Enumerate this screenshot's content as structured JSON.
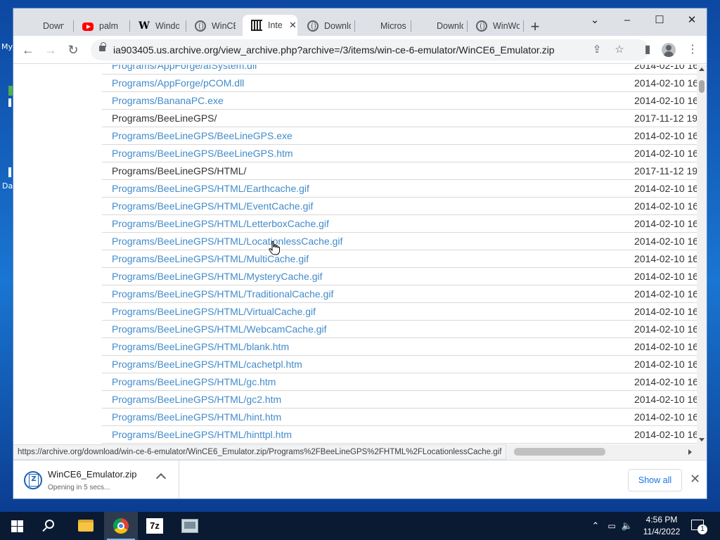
{
  "desktop": {
    "labels": [
      "My",
      "Da"
    ]
  },
  "tabs": [
    {
      "label": "Downlo",
      "icon": "microsoft-icon"
    },
    {
      "label": "palm o",
      "icon": "youtube-icon"
    },
    {
      "label": "Windo",
      "icon": "wikipedia-icon"
    },
    {
      "label": "WinCE",
      "icon": "globe-icon"
    },
    {
      "label": "Inte",
      "icon": "internet-archive-icon",
      "active": true
    },
    {
      "label": "Downlo",
      "icon": "globe-icon"
    },
    {
      "label": "Micros",
      "icon": "microsoft-icon"
    },
    {
      "label": "Downlo",
      "icon": "microsoft-icon"
    },
    {
      "label": "WinWo",
      "icon": "globe-icon"
    }
  ],
  "window_controls": {
    "minimize": "–",
    "maximize": "☐",
    "close": "✕",
    "tab_search": "⌄",
    "new_tab": "+"
  },
  "toolbar": {
    "url": "ia903405.us.archive.org/view_archive.php?archive=/3/items/win-ce-6-emulator/WinCE6_Emulator.zip"
  },
  "files": [
    {
      "name": "Programs/AppForge/afSystem.dll",
      "date": "2014-02-10 16",
      "folder": false
    },
    {
      "name": "Programs/AppForge/pCOM.dll",
      "date": "2014-02-10 16",
      "folder": false
    },
    {
      "name": "Programs/BananaPC.exe",
      "date": "2014-02-10 16",
      "folder": false
    },
    {
      "name": "Programs/BeeLineGPS/",
      "date": "2017-11-12 19",
      "folder": true
    },
    {
      "name": "Programs/BeeLineGPS/BeeLineGPS.exe",
      "date": "2014-02-10 16",
      "folder": false
    },
    {
      "name": "Programs/BeeLineGPS/BeeLineGPS.htm",
      "date": "2014-02-10 16",
      "folder": false
    },
    {
      "name": "Programs/BeeLineGPS/HTML/",
      "date": "2017-11-12 19",
      "folder": true
    },
    {
      "name": "Programs/BeeLineGPS/HTML/Earthcache.gif",
      "date": "2014-02-10 16",
      "folder": false
    },
    {
      "name": "Programs/BeeLineGPS/HTML/EventCache.gif",
      "date": "2014-02-10 16",
      "folder": false
    },
    {
      "name": "Programs/BeeLineGPS/HTML/LetterboxCache.gif",
      "date": "2014-02-10 16",
      "folder": false
    },
    {
      "name": "Programs/BeeLineGPS/HTML/LocationlessCache.gif",
      "date": "2014-02-10 16",
      "folder": false
    },
    {
      "name": "Programs/BeeLineGPS/HTML/MultiCache.gif",
      "date": "2014-02-10 16",
      "folder": false
    },
    {
      "name": "Programs/BeeLineGPS/HTML/MysteryCache.gif",
      "date": "2014-02-10 16",
      "folder": false
    },
    {
      "name": "Programs/BeeLineGPS/HTML/TraditionalCache.gif",
      "date": "2014-02-10 16",
      "folder": false
    },
    {
      "name": "Programs/BeeLineGPS/HTML/VirtualCache.gif",
      "date": "2014-02-10 16",
      "folder": false
    },
    {
      "name": "Programs/BeeLineGPS/HTML/WebcamCache.gif",
      "date": "2014-02-10 16",
      "folder": false
    },
    {
      "name": "Programs/BeeLineGPS/HTML/blank.htm",
      "date": "2014-02-10 16",
      "folder": false
    },
    {
      "name": "Programs/BeeLineGPS/HTML/cachetpl.htm",
      "date": "2014-02-10 16",
      "folder": false
    },
    {
      "name": "Programs/BeeLineGPS/HTML/gc.htm",
      "date": "2014-02-10 16",
      "folder": false
    },
    {
      "name": "Programs/BeeLineGPS/HTML/gc2.htm",
      "date": "2014-02-10 16",
      "folder": false
    },
    {
      "name": "Programs/BeeLineGPS/HTML/hint.htm",
      "date": "2014-02-10 16",
      "folder": false
    },
    {
      "name": "Programs/BeeLineGPS/HTML/hinttpl.htm",
      "date": "2014-02-10 16",
      "folder": false
    }
  ],
  "status_url": "https://archive.org/download/win-ce-6-emulator/WinCE6_Emulator.zip/Programs%2FBeeLineGPS%2FHTML%2FLocationlessCache.gif",
  "download": {
    "filename": "WinCE6_Emulator.zip",
    "status": "Opening in 5 secs...",
    "show_all": "Show all"
  },
  "taskbar": {
    "sevenzip_label": "7z",
    "time": "4:56 PM",
    "date": "11/4/2022",
    "notification_count": "1"
  },
  "colors": {
    "link": "#428bca",
    "accent": "#1a73e8",
    "taskbar": "#0a1a33"
  }
}
